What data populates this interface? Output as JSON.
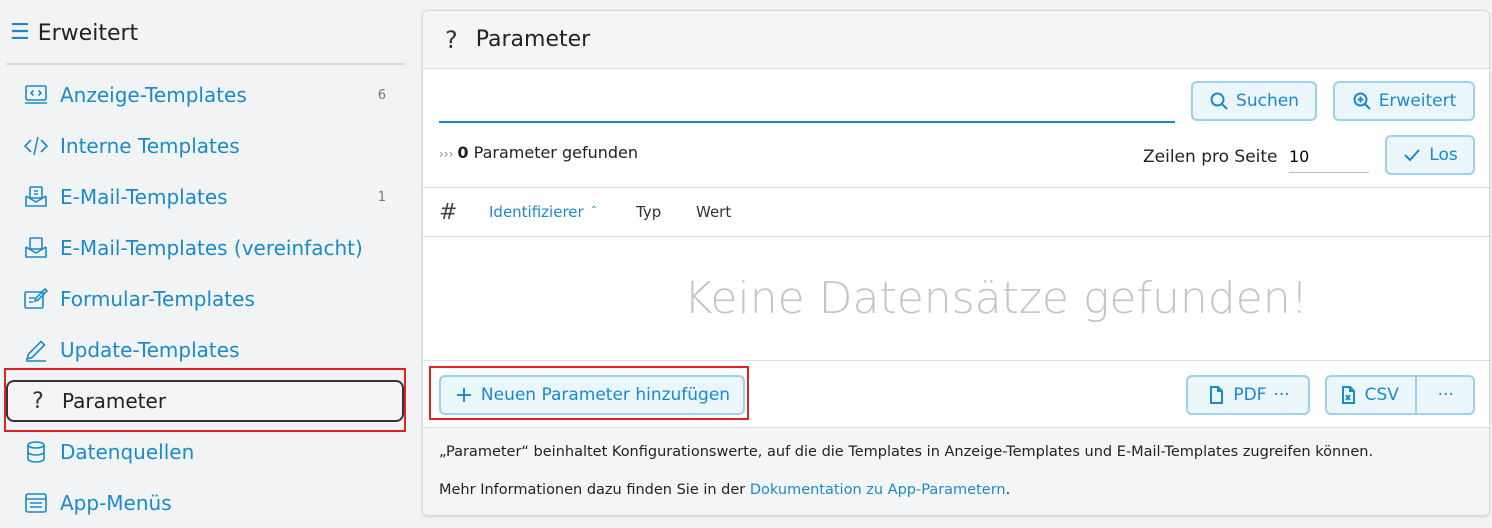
{
  "sidebar": {
    "title": "Erweitert",
    "items": [
      {
        "label": "Anzeige-Templates",
        "badge": "6",
        "icon": "display-code-icon"
      },
      {
        "label": "Interne Templates",
        "badge": "",
        "icon": "code-icon"
      },
      {
        "label": "E-Mail-Templates",
        "badge": "1",
        "icon": "mail-inbox-icon"
      },
      {
        "label": "E-Mail-Templates (vereinfacht)",
        "badge": "",
        "icon": "mail-simple-icon"
      },
      {
        "label": "Formular-Templates",
        "badge": "",
        "icon": "form-edit-icon"
      },
      {
        "label": "Update-Templates",
        "badge": "",
        "icon": "pencil-icon"
      },
      {
        "label": "Parameter",
        "badge": "",
        "icon": "question-icon"
      },
      {
        "label": "Datenquellen",
        "badge": "",
        "icon": "database-icon"
      },
      {
        "label": "App-Menüs",
        "badge": "",
        "icon": "menu-list-icon"
      }
    ]
  },
  "panel": {
    "title": "Parameter",
    "title_icon": "?",
    "search": {
      "value": "",
      "placeholder": ""
    },
    "search_button": "Suchen",
    "advanced_button": "Erweitert",
    "found_count": "0",
    "found_text": "Parameter gefunden",
    "rows_label": "Zeilen pro Seite",
    "rows_value": "10",
    "go_button": "Los",
    "columns": {
      "hash": "#",
      "identifier": "Identifizierer",
      "type": "Typ",
      "value": "Wert"
    },
    "empty_text": "Keine Datensätze gefunden!",
    "add_button": "Neuen Parameter hinzufügen",
    "pdf_button": "PDF",
    "csv_button": "CSV",
    "more_symbol": "···",
    "footer_line1": "„Parameter“ beinhaltet Konfigurationswerte, auf die die Templates in Anzeige-Templates und E-Mail-Templates zugreifen können.",
    "footer_line2_prefix": "Mehr Informationen dazu finden Sie in der",
    "footer_link": "Dokumentation zu App-Parametern",
    "footer_line2_suffix": "."
  },
  "colors": {
    "accent": "#1a8acb",
    "highlight": "#e02424"
  }
}
